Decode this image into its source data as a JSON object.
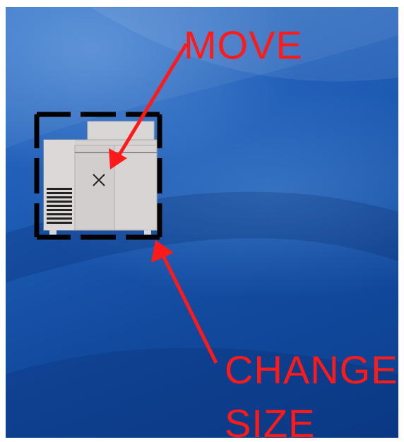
{
  "desktop": {
    "background_colors": [
      "#2f6fc6",
      "#124a9e",
      "#0d3f8d"
    ]
  },
  "widget": {
    "icon": "appliance-icon",
    "move_handle_icon": "close-x-icon",
    "selection_color": "#000000"
  },
  "annotations": {
    "color": "#ff1a1a",
    "move_label": "MOVE",
    "change_label": "CHANGE",
    "size_label": "SIZE"
  }
}
